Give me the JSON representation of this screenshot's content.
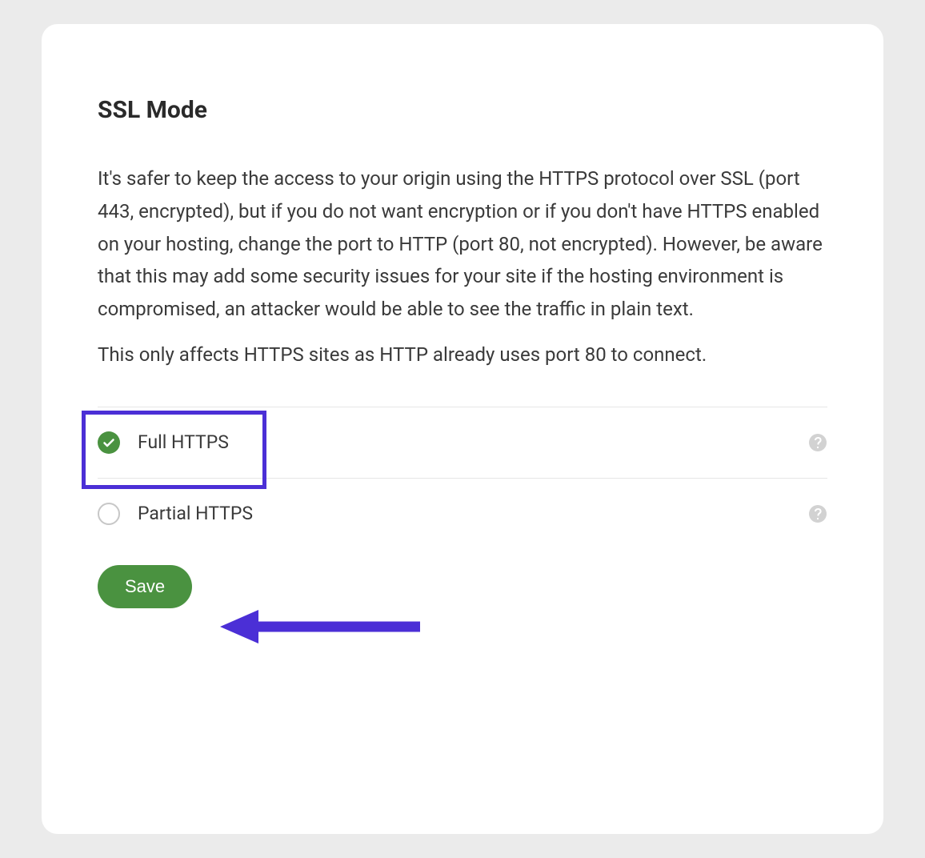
{
  "title": "SSL Mode",
  "description_p1": "It's safer to keep the access to your origin using the HTTPS protocol over SSL (port 443, encrypted), but if you do not want encryption or if you don't have HTTPS enabled on your hosting, change the port to HTTP (port 80, not encrypted). However, be aware that this may add some security issues for your site if the hosting environment is compromised, an attacker would be able to see the traffic in plain text.",
  "description_p2": "This only affects HTTPS sites as HTTP already uses port 80 to connect.",
  "options": [
    {
      "label": "Full HTTPS",
      "selected": true
    },
    {
      "label": "Partial HTTPS",
      "selected": false
    }
  ],
  "save_label": "Save",
  "colors": {
    "accent": "#4a9240",
    "highlight": "#4b2fd6"
  }
}
